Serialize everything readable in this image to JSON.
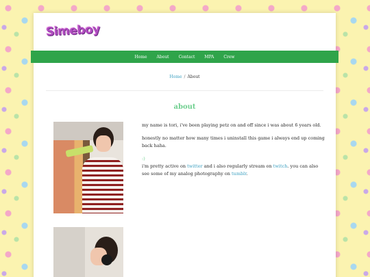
{
  "site": {
    "logo_text": "Simeboy"
  },
  "nav": {
    "items": [
      "Home",
      "About",
      "Contact",
      "MPA",
      "Crew"
    ]
  },
  "breadcrumb": {
    "home": "Home",
    "separator": "/",
    "current": "About"
  },
  "page": {
    "title": "about"
  },
  "content": {
    "p1": "my name is tori, i've been playing petz on and off since i was about 6 years old.",
    "p2": "honestly no matter how many times i uninstall this game i always end up coming back haha.",
    "smiley": ":)",
    "p3_before": "i'm pretty active on ",
    "p3_link1": "twitter",
    "p3_mid1": " and i also regularly stream on ",
    "p3_link2": "twitch",
    "p3_mid2": ". you can also see some of my analog photography on ",
    "p3_link3": "tumblr",
    "p3_end": "."
  },
  "colors": {
    "nav_bg": "#2fa44a",
    "title": "#6fcf8f",
    "link": "#3a9fc0",
    "background": "#fbf3b0"
  }
}
